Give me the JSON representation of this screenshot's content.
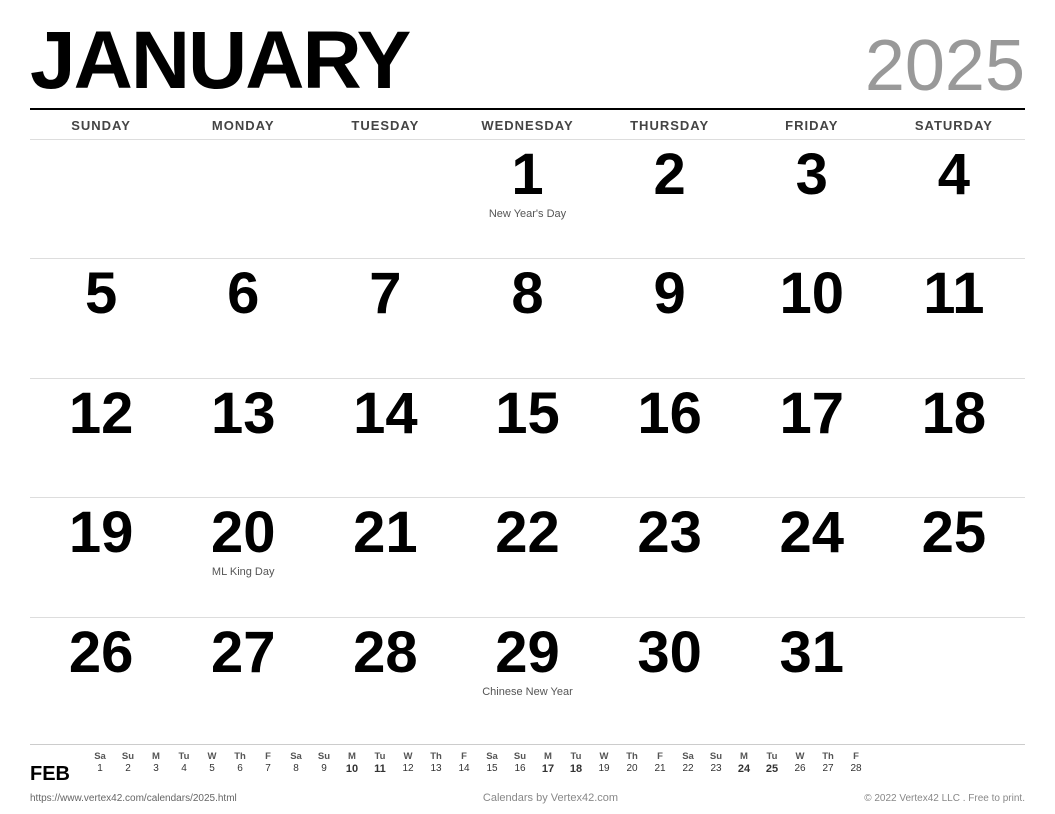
{
  "header": {
    "month": "JANUARY",
    "year": "2025"
  },
  "days_of_week": [
    "SUNDAY",
    "MONDAY",
    "TUESDAY",
    "WEDNESDAY",
    "THURSDAY",
    "FRIDAY",
    "SATURDAY"
  ],
  "weeks": [
    [
      {
        "day": "",
        "holiday": ""
      },
      {
        "day": "",
        "holiday": ""
      },
      {
        "day": "",
        "holiday": ""
      },
      {
        "day": "1",
        "holiday": "New Year's Day"
      },
      {
        "day": "2",
        "holiday": ""
      },
      {
        "day": "3",
        "holiday": ""
      },
      {
        "day": "4",
        "holiday": ""
      }
    ],
    [
      {
        "day": "5",
        "holiday": ""
      },
      {
        "day": "6",
        "holiday": ""
      },
      {
        "day": "7",
        "holiday": ""
      },
      {
        "day": "8",
        "holiday": ""
      },
      {
        "day": "9",
        "holiday": ""
      },
      {
        "day": "10",
        "holiday": ""
      },
      {
        "day": "11",
        "holiday": ""
      }
    ],
    [
      {
        "day": "12",
        "holiday": ""
      },
      {
        "day": "13",
        "holiday": ""
      },
      {
        "day": "14",
        "holiday": ""
      },
      {
        "day": "15",
        "holiday": ""
      },
      {
        "day": "16",
        "holiday": ""
      },
      {
        "day": "17",
        "holiday": ""
      },
      {
        "day": "18",
        "holiday": ""
      }
    ],
    [
      {
        "day": "19",
        "holiday": ""
      },
      {
        "day": "20",
        "holiday": "ML King Day"
      },
      {
        "day": "21",
        "holiday": ""
      },
      {
        "day": "22",
        "holiday": ""
      },
      {
        "day": "23",
        "holiday": ""
      },
      {
        "day": "24",
        "holiday": ""
      },
      {
        "day": "25",
        "holiday": ""
      }
    ],
    [
      {
        "day": "26",
        "holiday": ""
      },
      {
        "day": "27",
        "holiday": ""
      },
      {
        "day": "28",
        "holiday": ""
      },
      {
        "day": "29",
        "holiday": "Chinese New Year"
      },
      {
        "day": "30",
        "holiday": ""
      },
      {
        "day": "31",
        "holiday": ""
      },
      {
        "day": "",
        "holiday": ""
      }
    ]
  ],
  "mini_calendar": {
    "label": "FEB",
    "headers": [
      "Sa",
      "Su",
      "M",
      "Tu",
      "W",
      "Th",
      "F",
      "Sa",
      "Su",
      "M",
      "Tu",
      "W",
      "Th",
      "F",
      "Sa",
      "Su",
      "M",
      "Tu",
      "W",
      "Th",
      "F",
      "Sa",
      "Su",
      "M",
      "Tu",
      "W",
      "Th",
      "F"
    ],
    "dates": [
      "1",
      "2",
      "3",
      "4",
      "5",
      "6",
      "7",
      "8",
      "9",
      "10",
      "11",
      "12",
      "13",
      "14",
      "15",
      "16",
      "17",
      "18",
      "19",
      "20",
      "21",
      "22",
      "23",
      "24",
      "25",
      "26",
      "27",
      "28"
    ],
    "bold_dates": [
      "10",
      "11",
      "17",
      "18",
      "24",
      "25"
    ]
  },
  "footer": {
    "url": "https://www.vertex42.com/calendars/2025.html",
    "credit": "Calendars by Vertex42.com",
    "copyright": "© 2022 Vertex42 LLC . Free to print."
  }
}
